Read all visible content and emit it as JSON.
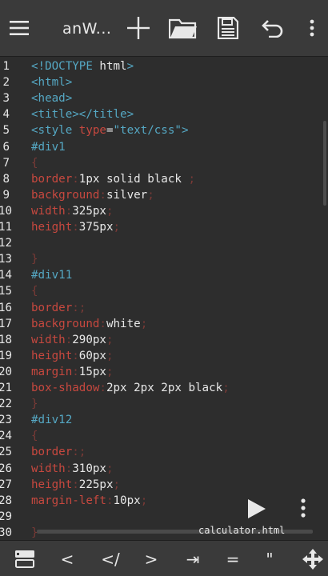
{
  "toolbar": {
    "title": "anW...",
    "icons": [
      "menu-icon",
      "plus-icon",
      "folder-icon",
      "save-icon",
      "undo-icon",
      "more-vertical-icon"
    ]
  },
  "editor": {
    "lines": [
      {
        "n": "1",
        "t": [
          [
            "tag",
            "<!DOCTYPE "
          ],
          [
            "plain",
            "html"
          ],
          [
            "tag",
            ">"
          ]
        ]
      },
      {
        "n": "2",
        "t": [
          [
            "tag",
            "<html>"
          ]
        ]
      },
      {
        "n": "3",
        "t": [
          [
            "tag",
            "<head>"
          ]
        ]
      },
      {
        "n": "4",
        "t": [
          [
            "tag",
            "<title></title>"
          ]
        ]
      },
      {
        "n": "5",
        "t": [
          [
            "tag",
            "<style "
          ],
          [
            "prop",
            "type"
          ],
          [
            "plain",
            "="
          ],
          [
            "sel",
            "\"text/css\""
          ],
          [
            "tag",
            ">"
          ]
        ]
      },
      {
        "n": "6",
        "t": [
          [
            "sel",
            "#div1"
          ]
        ]
      },
      {
        "n": "7",
        "t": [
          [
            "brace",
            "{"
          ]
        ]
      },
      {
        "n": "8",
        "t": [
          [
            "prop",
            "border"
          ],
          [
            "punc",
            ":"
          ],
          [
            "val",
            "1px solid black "
          ],
          [
            "punc",
            ";"
          ]
        ]
      },
      {
        "n": "9",
        "t": [
          [
            "prop",
            "background"
          ],
          [
            "punc",
            ":"
          ],
          [
            "val",
            "silver"
          ],
          [
            "punc",
            ";"
          ]
        ]
      },
      {
        "n": "10",
        "t": [
          [
            "prop",
            "width"
          ],
          [
            "punc",
            ":"
          ],
          [
            "val",
            "325px"
          ],
          [
            "punc",
            ";"
          ]
        ]
      },
      {
        "n": "11",
        "t": [
          [
            "prop",
            "height"
          ],
          [
            "punc",
            ":"
          ],
          [
            "val",
            "375px"
          ],
          [
            "punc",
            ";"
          ]
        ]
      },
      {
        "n": "12",
        "t": []
      },
      {
        "n": "13",
        "t": [
          [
            "brace",
            "}"
          ]
        ]
      },
      {
        "n": "14",
        "t": [
          [
            "sel",
            "#div11"
          ]
        ]
      },
      {
        "n": "15",
        "t": [
          [
            "brace",
            "{"
          ]
        ]
      },
      {
        "n": "16",
        "t": [
          [
            "prop",
            "border"
          ],
          [
            "punc",
            ":;"
          ]
        ]
      },
      {
        "n": "17",
        "t": [
          [
            "prop",
            "background"
          ],
          [
            "punc",
            ":"
          ],
          [
            "val",
            "white"
          ],
          [
            "punc",
            ";"
          ]
        ]
      },
      {
        "n": "18",
        "t": [
          [
            "prop",
            "width"
          ],
          [
            "punc",
            ":"
          ],
          [
            "val",
            "290px"
          ],
          [
            "punc",
            ";"
          ]
        ]
      },
      {
        "n": "19",
        "t": [
          [
            "prop",
            "height"
          ],
          [
            "punc",
            ":"
          ],
          [
            "val",
            "60px"
          ],
          [
            "punc",
            ";"
          ]
        ]
      },
      {
        "n": "20",
        "t": [
          [
            "prop",
            "margin"
          ],
          [
            "punc",
            ":"
          ],
          [
            "val",
            "15px"
          ],
          [
            "punc",
            ";"
          ]
        ]
      },
      {
        "n": "21",
        "t": [
          [
            "prop",
            "box-shadow"
          ],
          [
            "punc",
            ":"
          ],
          [
            "val",
            "2px 2px 2px black"
          ],
          [
            "punc",
            ";"
          ]
        ]
      },
      {
        "n": "22",
        "t": [
          [
            "brace",
            "}"
          ]
        ]
      },
      {
        "n": "23",
        "t": [
          [
            "sel",
            "#div12"
          ]
        ]
      },
      {
        "n": "24",
        "t": [
          [
            "brace",
            "{"
          ]
        ]
      },
      {
        "n": "25",
        "t": [
          [
            "prop",
            "border"
          ],
          [
            "punc",
            ":;"
          ]
        ]
      },
      {
        "n": "26",
        "t": [
          [
            "prop",
            "width"
          ],
          [
            "punc",
            ":"
          ],
          [
            "val",
            "310px"
          ],
          [
            "punc",
            ";"
          ]
        ]
      },
      {
        "n": "27",
        "t": [
          [
            "prop",
            "height"
          ],
          [
            "punc",
            ":"
          ],
          [
            "val",
            "225px"
          ],
          [
            "punc",
            ";"
          ]
        ]
      },
      {
        "n": "28",
        "t": [
          [
            "prop",
            "margin-left"
          ],
          [
            "punc",
            ":"
          ],
          [
            "val",
            "10px"
          ],
          [
            "punc",
            ";"
          ]
        ]
      },
      {
        "n": "29",
        "t": []
      },
      {
        "n": "30",
        "t": [
          [
            "brace",
            "}"
          ]
        ]
      }
    ],
    "file_name": "calculator.html"
  },
  "keybar": {
    "keys": [
      {
        "label": "",
        "icon": "panel-toggle-icon"
      },
      {
        "label": "<"
      },
      {
        "label": "</"
      },
      {
        "label": ">"
      },
      {
        "label": "⇥"
      },
      {
        "label": "="
      },
      {
        "label": "\""
      },
      {
        "label": "",
        "icon": "move-arrows-icon"
      }
    ]
  }
}
